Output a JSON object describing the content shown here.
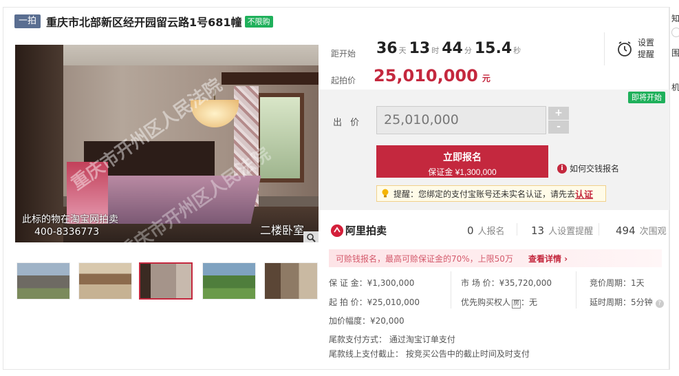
{
  "title": {
    "tag": "一拍",
    "text": "重庆市北部新区经开园留云路1号681幢",
    "badge": "不限购"
  },
  "photo": {
    "watermark": "重庆市开州区人民法院",
    "caption_line1": "此标的物在淘宝网拍卖",
    "caption_line2": "400-8336773",
    "caption_room": "二楼卧室"
  },
  "countdown": {
    "label": "距开始",
    "days": "36",
    "days_unit": "天",
    "hours": "13",
    "hours_unit": "时",
    "minutes": "44",
    "minutes_unit": "分",
    "seconds": "15.4",
    "seconds_unit": "秒"
  },
  "remind": {
    "line1": "设置",
    "line2": "提醒"
  },
  "start_price": {
    "label": "起拍价",
    "value": "25,010,000",
    "unit": "元"
  },
  "status_badge": "即将开始",
  "bid": {
    "label": "出 价",
    "value": "25,010,000",
    "plus": "+",
    "minus": "-"
  },
  "register": {
    "line1": "立即报名",
    "line2": "保证金 ¥1,300,000"
  },
  "how_pay": "如何交钱报名",
  "notice": {
    "text": "提醒：您绑定的支付宝账号还未实名认证，请先去",
    "link": "认证"
  },
  "ali": {
    "brand": "阿里拍卖"
  },
  "stats": [
    {
      "num": "0",
      "label": "人报名"
    },
    {
      "num": "13",
      "label": "人设置提醒"
    },
    {
      "num": "494",
      "label": "次围观"
    }
  ],
  "promo": {
    "text": "可赊钱报名，最高可赊保证金的70%，上限50万",
    "detail": "查看详情 ›"
  },
  "info": {
    "deposit": "保 证 金：¥1,300,000",
    "start": "起 拍 价：¥25,010,000",
    "increment": "加价幅度：¥20,000",
    "market": "市 场 价：¥35,720,000",
    "priority_label": "优先购买权人",
    "priority_tag": "房",
    "priority_value": "：无",
    "cycle": "竞价周期：1天",
    "delay": "延时周期：5分钟",
    "tail_method": "尾款支付方式：   通过淘宝订单支付",
    "tail_deadline": "尾款线上支付截止：   按竞买公告中的截止时间及时支付"
  },
  "rail": {
    "c1": "知",
    "c2": "围",
    "c3": "机"
  }
}
